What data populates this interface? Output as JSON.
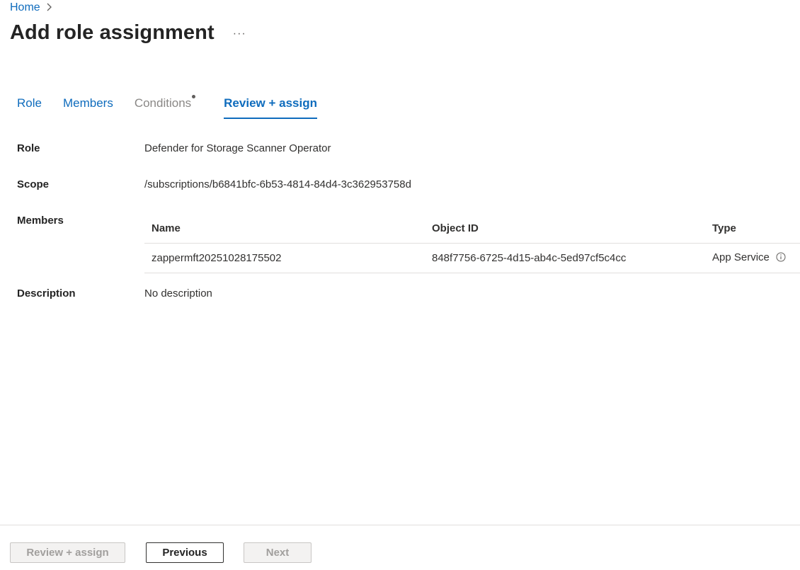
{
  "breadcrumb": {
    "home_label": "Home"
  },
  "header": {
    "title": "Add role assignment",
    "more_label": "···"
  },
  "tabs": [
    {
      "label": "Role",
      "state": "enabled"
    },
    {
      "label": "Members",
      "state": "enabled"
    },
    {
      "label": "Conditions",
      "state": "disabled"
    },
    {
      "label": "Review + assign",
      "state": "active"
    }
  ],
  "details": {
    "role_label": "Role",
    "role_value": "Defender for Storage Scanner Operator",
    "scope_label": "Scope",
    "scope_value": "/subscriptions/b6841bfc-6b53-4814-84d4-3c362953758d",
    "members_label": "Members",
    "description_label": "Description",
    "description_value": "No description"
  },
  "members_table": {
    "columns": [
      "Name",
      "Object ID",
      "Type"
    ],
    "rows": [
      {
        "name": "zappermft20251028175502",
        "object_id": "848f7756-6725-4d15-ab4c-5ed97cf5c4cc",
        "type": "App Service"
      }
    ]
  },
  "footer": {
    "review_assign_label": "Review + assign",
    "previous_label": "Previous",
    "next_label": "Next"
  },
  "colors": {
    "accent": "#0f6cbd",
    "disabled_text": "#8a8886",
    "border": "#e1dfdd"
  }
}
